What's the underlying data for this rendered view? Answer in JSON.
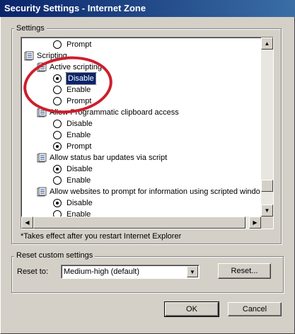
{
  "window": {
    "title": "Security Settings - Internet Zone"
  },
  "settings_group": {
    "label": "Settings"
  },
  "tree_rows": [
    {
      "kind": "radio",
      "label": "Prompt",
      "checked": false
    },
    {
      "kind": "category",
      "label": "Scripting"
    },
    {
      "kind": "setting",
      "label": "Active scripting"
    },
    {
      "kind": "radio",
      "label": "Disable",
      "checked": true,
      "selected": true
    },
    {
      "kind": "radio",
      "label": "Enable",
      "checked": false
    },
    {
      "kind": "radio",
      "label": "Prompt",
      "checked": false
    },
    {
      "kind": "setting",
      "label": "Allow Programmatic clipboard access"
    },
    {
      "kind": "radio",
      "label": "Disable",
      "checked": false
    },
    {
      "kind": "radio",
      "label": "Enable",
      "checked": false
    },
    {
      "kind": "radio",
      "label": "Prompt",
      "checked": true
    },
    {
      "kind": "setting",
      "label": "Allow status bar updates via script"
    },
    {
      "kind": "radio",
      "label": "Disable",
      "checked": true
    },
    {
      "kind": "radio",
      "label": "Enable",
      "checked": false
    },
    {
      "kind": "setting",
      "label": "Allow websites to prompt for information using scripted windo"
    },
    {
      "kind": "radio",
      "label": "Disable",
      "checked": true
    },
    {
      "kind": "radio",
      "label": "Enable",
      "checked": false
    }
  ],
  "note": "*Takes effect after you restart Internet Explorer",
  "reset_group": {
    "label": "Reset custom settings",
    "reset_to_label": "Reset to:",
    "selected_level": "Medium-high (default)",
    "reset_button": "Reset..."
  },
  "buttons": {
    "ok": "OK",
    "cancel": "Cancel"
  },
  "colors": {
    "annotation_ring": "#cc1f2c",
    "titlebar": "#0a246a",
    "selection": "#0a246a"
  }
}
